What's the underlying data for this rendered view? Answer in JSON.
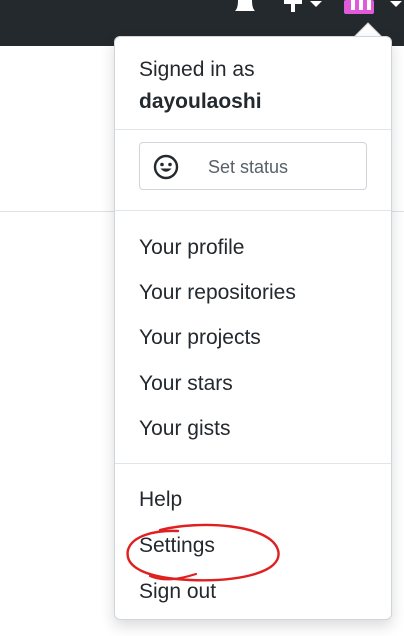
{
  "header": {
    "icons": [
      "bell-icon",
      "plus-icon",
      "avatar",
      "caret-down-icon"
    ],
    "background": "#24292e",
    "avatar_color": "#e05bd8"
  },
  "dropdown": {
    "signed_in_label": "Signed in as",
    "username": "dayoulaoshi",
    "set_status_label": "Set status",
    "status_icon": "smiley-icon",
    "menu_items": [
      "Your profile",
      "Your repositories",
      "Your projects",
      "Your stars",
      "Your gists"
    ],
    "footer_items": [
      "Help",
      "Settings",
      "Sign out"
    ]
  },
  "annotation": {
    "color": "#e02020",
    "target": "Settings"
  }
}
